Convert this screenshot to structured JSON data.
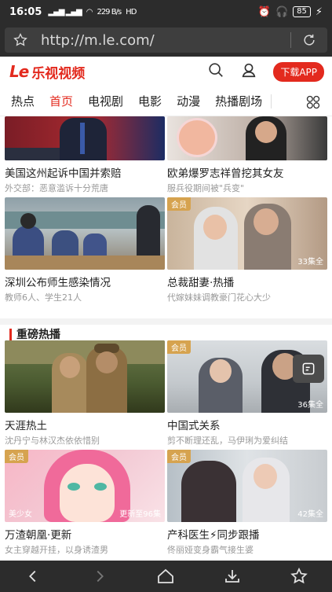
{
  "status_bar": {
    "time": "16:05",
    "signal": "4G",
    "speed": "229 B/s",
    "network": "HD",
    "battery": "85"
  },
  "browser": {
    "url": "http://m.le.com/"
  },
  "site": {
    "logo_mark": "Le",
    "logo_text": "乐视视频",
    "download_label": "下载APP"
  },
  "nav": {
    "tabs": [
      "热点",
      "首页",
      "电视剧",
      "电影",
      "动漫",
      "热播剧场"
    ],
    "active": "首页"
  },
  "hot_cards": [
    {
      "title": "美国这州起诉中国并索赔",
      "subtitle": "外交部：恶意滥诉十分荒唐"
    },
    {
      "title": "欧弟爆罗志祥曾挖其女友",
      "subtitle": "服兵役期间被\"兵变\""
    },
    {
      "title": "深圳公布师生感染情况",
      "subtitle": "教师6人、学生21人"
    },
    {
      "title": "总裁甜妻·热播",
      "subtitle": "代嫁妹妹调教豪门花心大少",
      "badge": "会员",
      "episodes": "33集全"
    }
  ],
  "section": {
    "title": "重磅热播"
  },
  "drama_cards": [
    {
      "title": "天涯热土",
      "subtitle": "沈丹宁与林汉杰依依惜别"
    },
    {
      "title": "中国式关系",
      "subtitle": "剪不断理还乱，马伊琍为爱纠结",
      "badge": "会员",
      "episodes": "36集全"
    },
    {
      "title": "万渣朝凰·更新",
      "subtitle": "女主穿越开挂，以身诱渣男",
      "badge": "会员",
      "tag_left": "美少女",
      "episodes": "更新至96集"
    },
    {
      "title": "产科医生⚡同步跟播",
      "subtitle": "佟丽娅变身霸气接生婆",
      "badge": "会员",
      "episodes": "42集全"
    }
  ]
}
